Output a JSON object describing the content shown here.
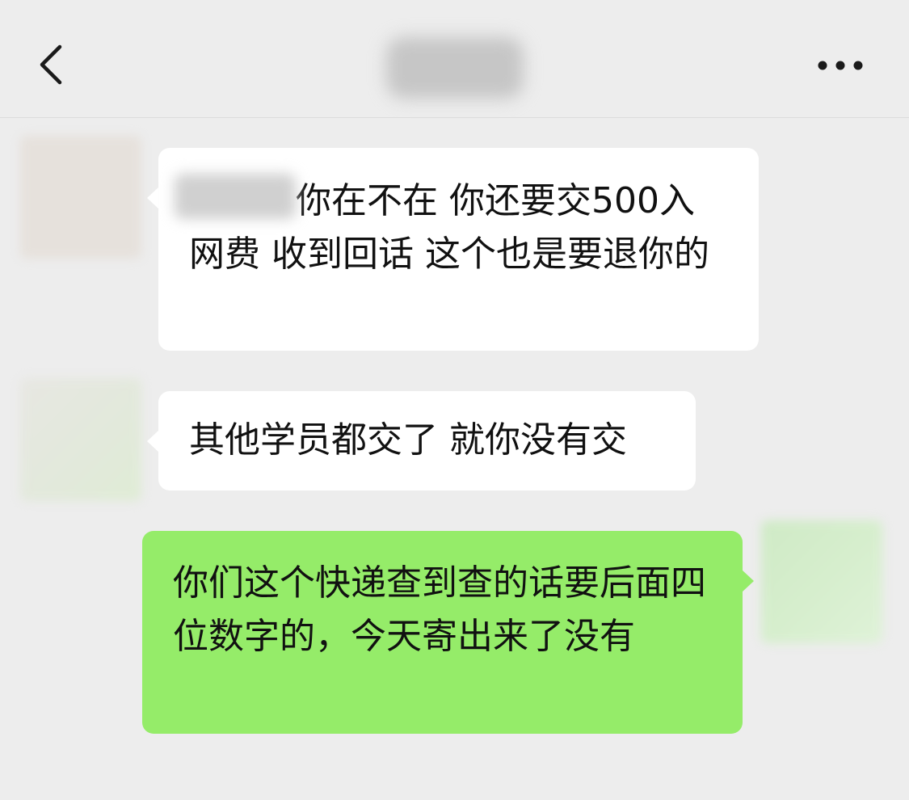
{
  "header": {
    "back_icon": "chevron-left-icon",
    "more_icon": "more-dots-icon"
  },
  "messages": [
    {
      "side": "incoming",
      "text_after_name": "你在不在 你还要交500入网费 收到回话 这个也是要退你的"
    },
    {
      "side": "incoming",
      "text": "其他学员都交了 就你没有交"
    },
    {
      "side": "outgoing",
      "text": "你们这个快递查到查的话要后面四位数字的，今天寄出来了没有"
    }
  ],
  "colors": {
    "background": "#ededed",
    "incoming_bubble": "#ffffff",
    "outgoing_bubble": "#95ec69",
    "text": "#111111"
  }
}
